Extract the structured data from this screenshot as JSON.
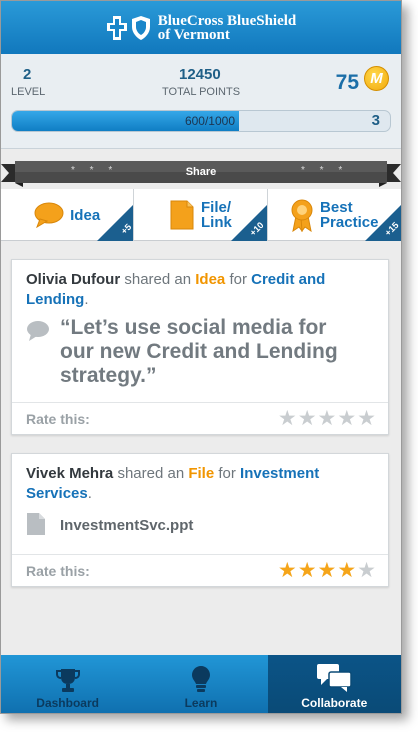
{
  "header": {
    "brand_line1": "BlueCross BlueShield",
    "brand_line2": "of Vermont",
    "logo_icons": [
      "blue-cross-icon",
      "blue-shield-icon"
    ]
  },
  "stats": {
    "level_value": "2",
    "level_label": "LEVEL",
    "points_value": "12450",
    "points_label": "TOTAL POINTS",
    "score_value": "75",
    "coin_letter": "M",
    "progress_text": "600/1000",
    "progress_fraction": 0.6,
    "next_level": "3"
  },
  "share": {
    "label": "Share",
    "dots": "* * *",
    "buttons": [
      {
        "label": "Idea",
        "badge": "+5",
        "icon": "speech-bubble-icon"
      },
      {
        "label_line1": "File/",
        "label_line2": "Link",
        "badge": "+10",
        "icon": "document-icon"
      },
      {
        "label_line1": "Best",
        "label_line2": "Practice",
        "badge": "+15",
        "icon": "award-ribbon-icon"
      }
    ]
  },
  "feed": [
    {
      "user": "Olivia Dufour",
      "verb": "shared an",
      "type": "Idea",
      "prep": "for",
      "topic": "Credit and Lending",
      "end": ".",
      "quote": "“Let’s use social media for our new Credit and Lending strategy.”",
      "rate_label": "Rate this:",
      "rating": 0,
      "max_rating": 5
    },
    {
      "user": "Vivek Mehra",
      "verb": "shared an",
      "type": "File",
      "prep": "for",
      "topic": "Investment Services",
      "end": ".",
      "file_name": "InvestmentSvc.ppt",
      "rate_label": "Rate this:",
      "rating": 4,
      "max_rating": 5
    }
  ],
  "nav": {
    "items": [
      {
        "label": "Dashboard",
        "icon": "trophy-icon",
        "active": false
      },
      {
        "label": "Learn",
        "icon": "lightbulb-icon",
        "active": false
      },
      {
        "label": "Collaborate",
        "icon": "chat-bubbles-icon",
        "active": true
      }
    ]
  },
  "colors": {
    "brand_blue": "#1178bd",
    "accent_orange": "#f19500",
    "link_blue": "#1672b8",
    "star_on": "#f5a51a"
  }
}
